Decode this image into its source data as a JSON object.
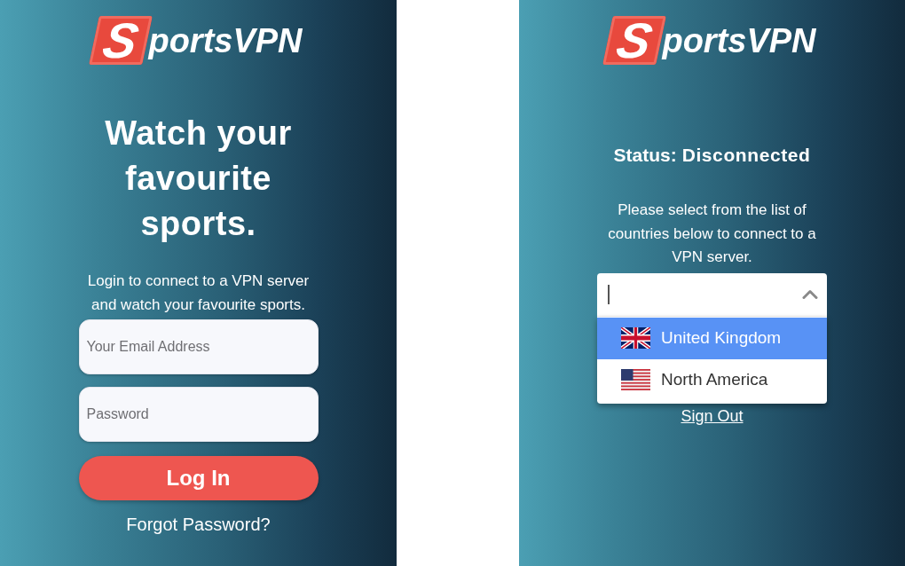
{
  "login_screen": {
    "logo": {
      "mark": "S",
      "text": "portsVPN"
    },
    "headline": "Watch your favourite sports.",
    "subtitle": "Login to connect to a VPN server and watch your favourite sports.",
    "email_field": {
      "placeholder": "Your Email Address"
    },
    "password_field": {
      "placeholder": "Password"
    },
    "login_button": "Log In",
    "forgot_link": "Forgot Password?"
  },
  "server_screen": {
    "logo": {
      "mark": "S",
      "text": "portsVPN"
    },
    "status": {
      "label": "Status:",
      "value": "Disconnected"
    },
    "instructions": "Please select from the list of countries below to connect to a VPN server.",
    "country_select": {
      "expanded": true,
      "options": [
        {
          "label": "United Kingdom",
          "selected": true
        },
        {
          "label": "North America",
          "selected": false
        }
      ]
    },
    "sign_out_link": "Sign Out"
  }
}
